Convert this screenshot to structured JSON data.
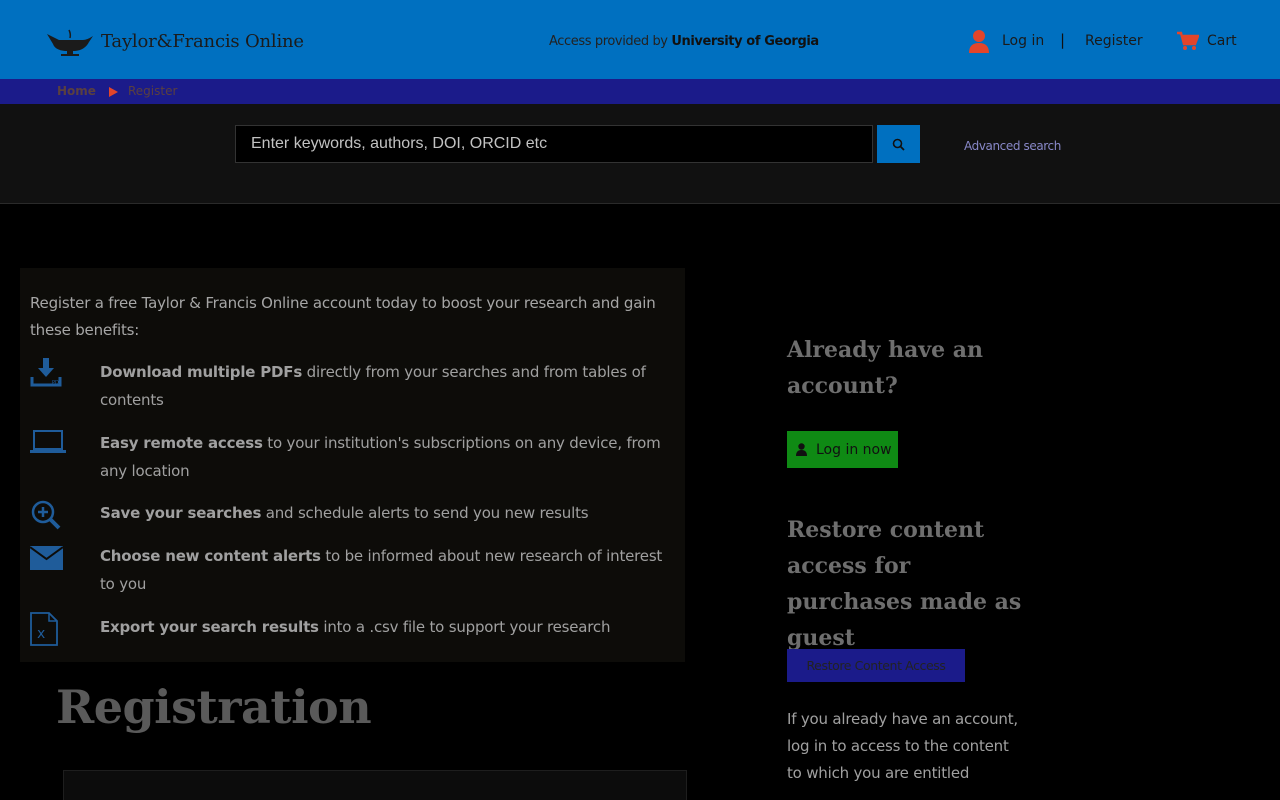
{
  "header": {
    "logo_text": "Taylor&Francis Online",
    "access_prefix": "Access provided by",
    "access_institution": "University of Georgia",
    "login_label": "Log in",
    "separator": "|",
    "register_label": "Register",
    "cart_label": "Cart"
  },
  "breadcrumb": {
    "items": [
      "Home",
      "Register"
    ]
  },
  "search": {
    "placeholder": "Enter keywords, authors, DOI, ORCID etc",
    "advanced_label": "Advanced search"
  },
  "benefits": {
    "intro": "Register a free Taylor & Francis Online account today to boost your research and gain these benefits:",
    "items": [
      {
        "icon": "download-icon",
        "bold": "Download multiple PDFs",
        "rest": " directly from your searches and from tables of contents"
      },
      {
        "icon": "laptop-icon",
        "bold": "Easy remote access",
        "rest": " to your institution's subscriptions on any device, from any location"
      },
      {
        "icon": "zoom-in-icon",
        "bold": "Save your searches",
        "rest": " and schedule alerts to send you new results"
      },
      {
        "icon": "envelope-icon",
        "bold": "Choose new content alerts",
        "rest": " to be informed about new research of interest to you"
      },
      {
        "icon": "excel-file-icon",
        "bold": "Export your search results",
        "rest": " into a .csv file to support your research"
      }
    ]
  },
  "registration": {
    "title": "Registration"
  },
  "sidebar": {
    "have_account_heading": "Already have an account?",
    "login_now_label": "Log in now",
    "restore_heading": "Restore content access for purchases made as guest",
    "restore_button_label": "Restore Content Access",
    "note": "If you already have an account, log in to access to the content to which you are entitled"
  },
  "colors": {
    "header_bg": "#0070c0",
    "breadcrumb_bg": "#1b1b8a",
    "login_now_bg": "#0f8a14",
    "restore_bg": "#1b1b8a",
    "accent_red": "#e2452a"
  }
}
